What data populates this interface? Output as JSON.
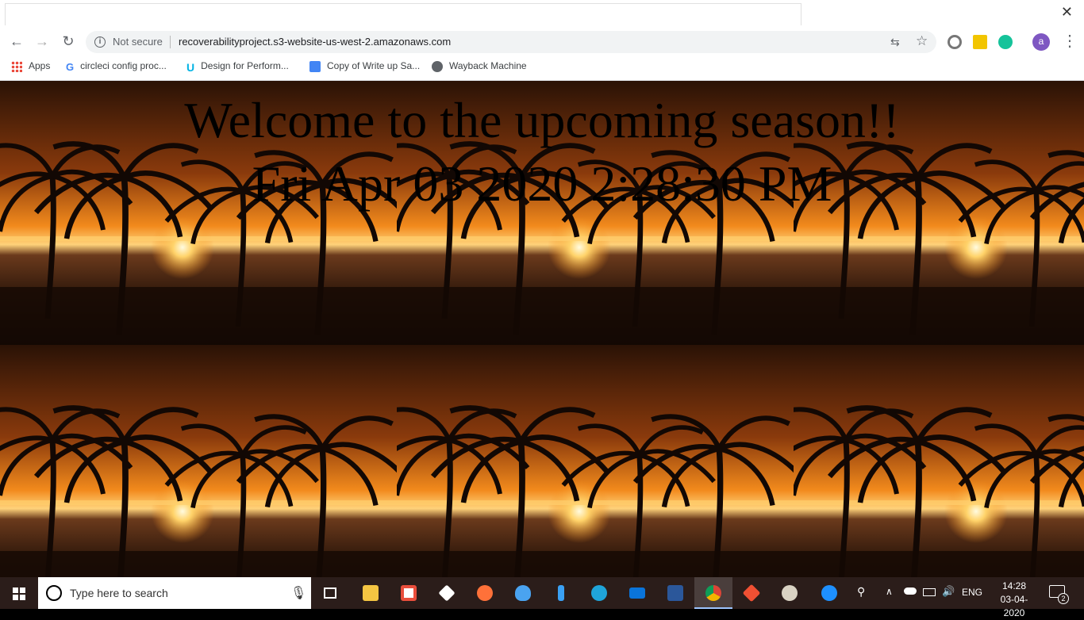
{
  "browser": {
    "close_glyph": "✕",
    "back_glyph": "←",
    "forward_glyph": "→",
    "reload_glyph": "↻",
    "info_glyph": "i",
    "security_label": "Not secure",
    "url": "recoverabilityproject.s3-website-us-west-2.amazonaws.com",
    "translate_glyph": "⇆",
    "star_glyph": "☆",
    "avatar_letter": "a",
    "menu_glyph": "⋮"
  },
  "bookmarks": [
    {
      "label": "Apps",
      "icon": "apps-grid-icon"
    },
    {
      "label": "circleci config proc...",
      "icon": "google-icon"
    },
    {
      "label": "Design for Perform...",
      "icon": "udacity-icon"
    },
    {
      "label": "Copy of Write up Sa...",
      "icon": "google-docs-icon"
    },
    {
      "label": "Wayback Machine",
      "icon": "globe-icon"
    }
  ],
  "page": {
    "headline": "Welcome to the upcoming season!!",
    "datetime": "Fri Apr 03 2020 2:28:30 PM"
  },
  "taskbar": {
    "search_placeholder": "Type here to search",
    "language": "ENG",
    "time": "14:28",
    "date": "03-04-2020",
    "notification_count": "2"
  },
  "colors": {
    "sunset_orange": "#f28a1c",
    "taskbar_bg": "#2b1d1a",
    "avatar_purple": "#7e57c2"
  }
}
